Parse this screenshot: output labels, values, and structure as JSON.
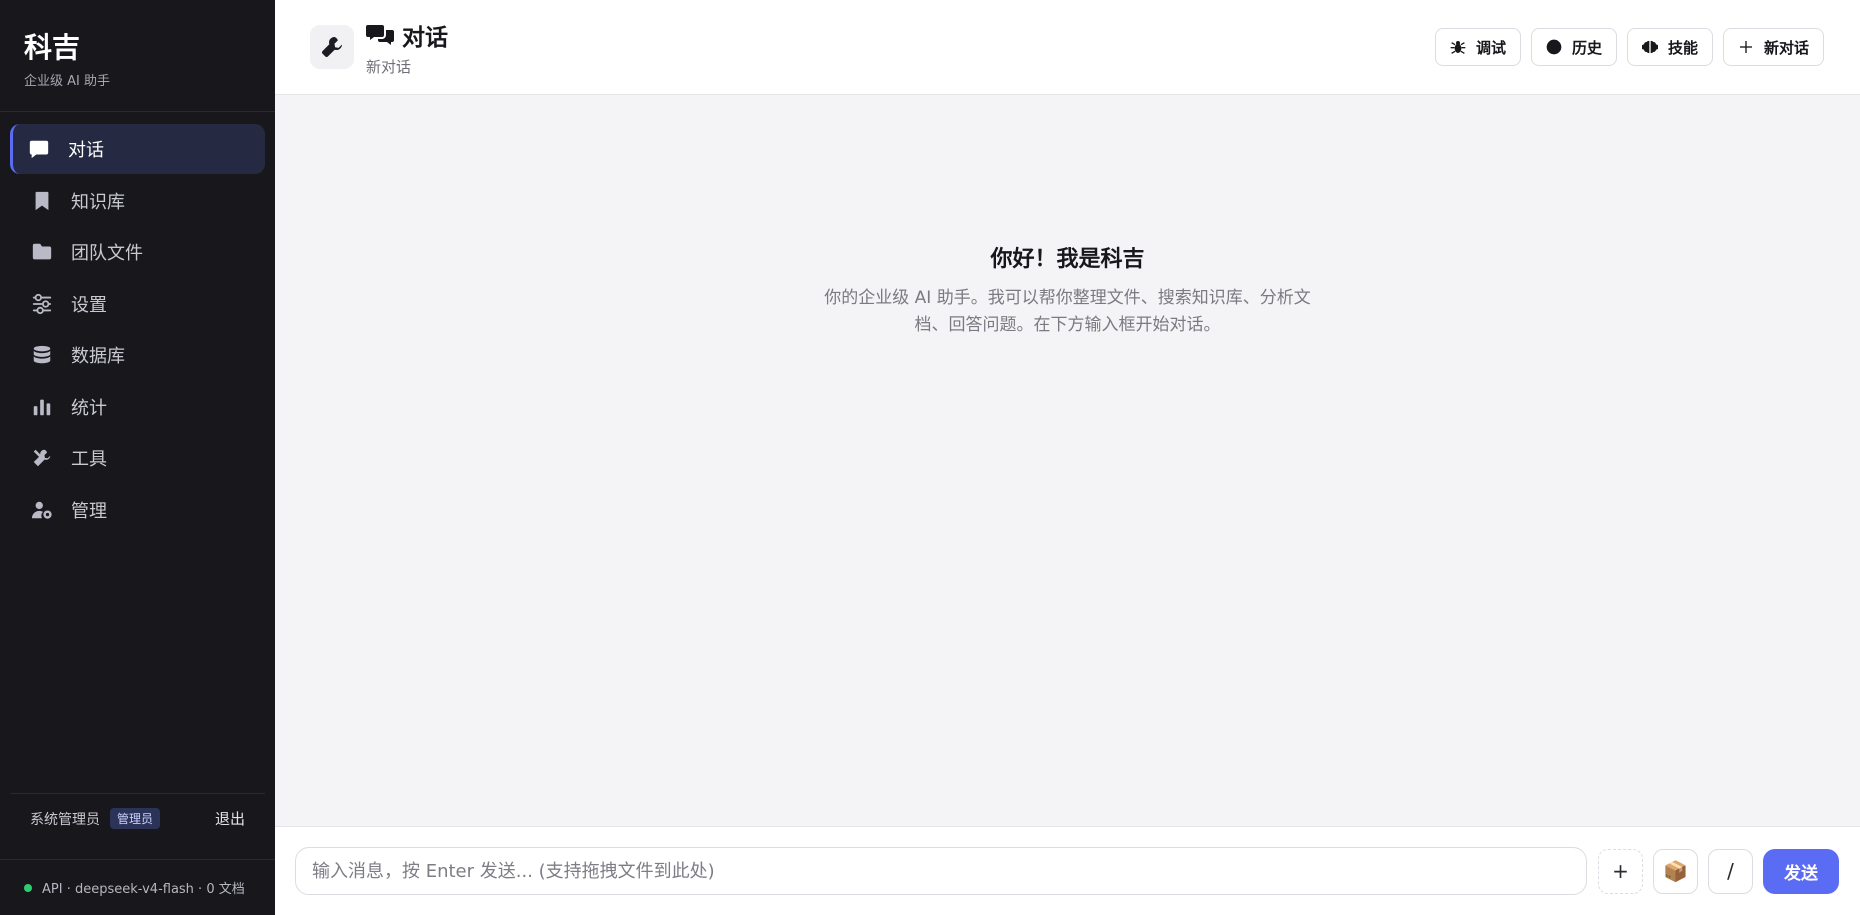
{
  "sidebar": {
    "brand_title": "科吉",
    "brand_subtitle": "企业级 AI 助手",
    "items": [
      {
        "label": "对话",
        "icon": "chat-bubble-icon",
        "active": true
      },
      {
        "label": "知识库",
        "icon": "bookmark-icon"
      },
      {
        "label": "团队文件",
        "icon": "folder-icon"
      },
      {
        "label": "设置",
        "icon": "sliders-icon"
      },
      {
        "label": "数据库",
        "icon": "database-icon"
      },
      {
        "label": "统计",
        "icon": "bar-chart-icon"
      },
      {
        "label": "工具",
        "icon": "tools-icon"
      },
      {
        "label": "管理",
        "icon": "user-gear-icon"
      }
    ],
    "user_name": "系统管理员",
    "role_badge": "管理员",
    "logout_label": "退出",
    "api_status": "API · deepseek-v4-flash · 0 文档",
    "status_color": "#2ecc71"
  },
  "header": {
    "title": "对话",
    "subtitle": "新对话",
    "actions": [
      {
        "label": "调试",
        "icon": "bug-icon"
      },
      {
        "label": "历史",
        "icon": "clock-icon"
      },
      {
        "label": "技能",
        "icon": "brain-icon"
      },
      {
        "label": "新对话",
        "icon": "plus-icon"
      }
    ]
  },
  "welcome": {
    "title": "你好！我是科吉",
    "text": "你的企业级 AI 助手。我可以帮你整理文件、搜索知识库、分析文档、回答问题。在下方输入框开始对话。"
  },
  "composer": {
    "placeholder": "输入消息，按 Enter 发送... (支持拖拽文件到此处)",
    "attach_label": "+",
    "package_label": "📦",
    "command_label": "/",
    "send_label": "发送"
  },
  "colors": {
    "accent": "#5a6cf4",
    "sidebar_bg": "#17171c"
  }
}
